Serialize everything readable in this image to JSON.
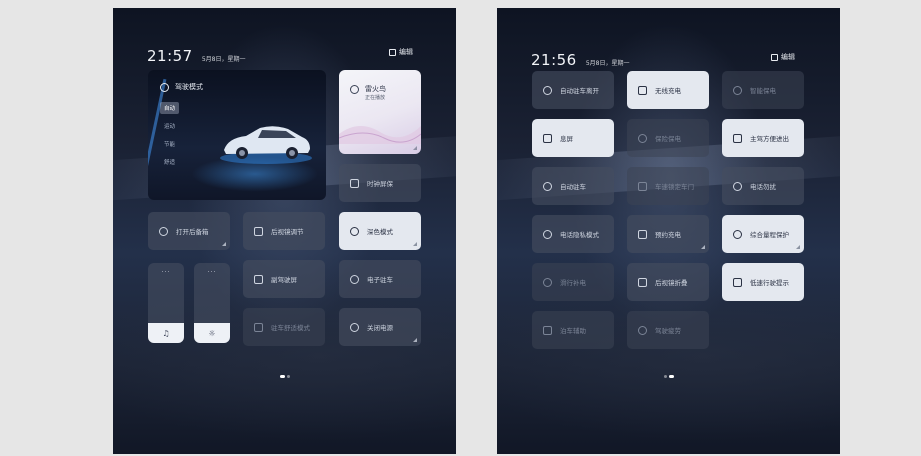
{
  "left": {
    "clock": "21:57",
    "date": "5月8日，星期一",
    "edit_label": "编辑",
    "drive_card": {
      "title": "驾驶模式",
      "modes": [
        "自动",
        "运动",
        "节能",
        "舒适"
      ]
    },
    "weather": {
      "name": "雷火鸟",
      "sub": "正在播放"
    },
    "tiles": [
      {
        "label": "时钟屏保",
        "icon": "clock-icon"
      },
      {
        "label": "打开后备箱",
        "icon": "trunk-icon"
      },
      {
        "label": "后视镜调节",
        "icon": "mirror-icon"
      },
      {
        "label": "深色模式",
        "icon": "moon-icon"
      },
      {
        "label": "副驾驶屏",
        "icon": "screen-icon"
      },
      {
        "label": "电子驻车",
        "icon": "parking-icon"
      },
      {
        "label": "驻车舒适模式",
        "icon": "seat-icon"
      },
      {
        "label": "关闭电源",
        "icon": "power-icon"
      }
    ],
    "sliders": [
      {
        "glyph": "♫",
        "more": "···"
      },
      {
        "glyph": "☼",
        "more": "···"
      }
    ]
  },
  "right": {
    "clock": "21:56",
    "date": "5月8日，星期一",
    "edit_label": "编辑",
    "tiles": [
      {
        "label": "自动驻车离开",
        "icon": "person-car-icon",
        "style": "dark"
      },
      {
        "label": "无线充电",
        "icon": "wireless-charge-icon",
        "style": "light"
      },
      {
        "label": "智能保电",
        "icon": "battery-icon",
        "style": "dim"
      },
      {
        "label": "息屏",
        "icon": "screen-off-icon",
        "style": "light"
      },
      {
        "label": "保险保电",
        "icon": "shield-battery-icon",
        "style": "dim"
      },
      {
        "label": "主驾方便进出",
        "icon": "seat-icon",
        "style": "light"
      },
      {
        "label": "自动驻车",
        "icon": "auto-hold-icon",
        "style": "dark"
      },
      {
        "label": "车速锁定车门",
        "icon": "lock-icon",
        "style": "dim"
      },
      {
        "label": "电话勿扰",
        "icon": "phone-icon",
        "style": "dark"
      },
      {
        "label": "电话隐私模式",
        "icon": "phone-private-icon",
        "style": "dark"
      },
      {
        "label": "预约充电",
        "icon": "schedule-charge-icon",
        "style": "dark"
      },
      {
        "label": "综合量程保护",
        "icon": "range-protect-icon",
        "style": "light"
      },
      {
        "label": "滑行补电",
        "icon": "coast-charge-icon",
        "style": "dim"
      },
      {
        "label": "后视镜折叠",
        "icon": "mirror-fold-icon",
        "style": "dark"
      },
      {
        "label": "低速行驶提示",
        "icon": "low-speed-icon",
        "style": "light"
      },
      {
        "label": "泊车辅助",
        "icon": "park-assist-icon",
        "style": "dim"
      },
      {
        "label": "驾驶疲劳",
        "icon": "fatigue-icon",
        "style": "dim"
      }
    ]
  }
}
